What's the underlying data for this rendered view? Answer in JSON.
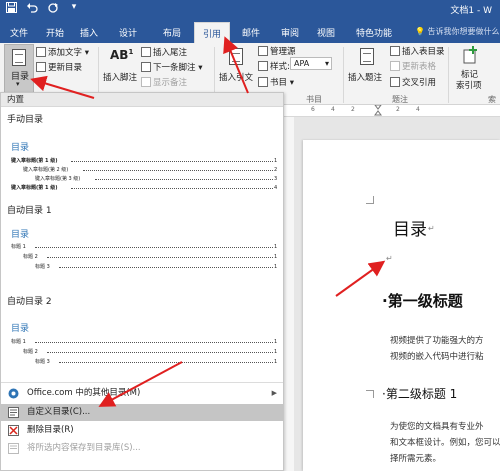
{
  "window": {
    "title": "文档1 - W",
    "qat": [
      "save-icon",
      "undo-icon",
      "redo-icon",
      "more-icon"
    ]
  },
  "tabs": [
    {
      "label": "文件"
    },
    {
      "label": "开始"
    },
    {
      "label": "插入"
    },
    {
      "label": "设计"
    },
    {
      "label": "布局"
    },
    {
      "label": "引用"
    },
    {
      "label": "邮件"
    },
    {
      "label": "审阅"
    },
    {
      "label": "视图"
    },
    {
      "label": "特色功能"
    }
  ],
  "tell_me": "告诉我你想要做什么",
  "ribbon": {
    "toc_label": "目录",
    "add_text": "添加文字",
    "update_toc": "更新目录",
    "insert_footnote": "插入脚注",
    "insert_endnote": "插入尾注",
    "next_footnote": "下一条脚注",
    "show_notes": "显示备注",
    "insert_citation": "插入引文",
    "manage_sources": "管理源",
    "style_label": "样式:",
    "style_value": "APA",
    "bibliography": "书目",
    "insert_caption": "插入题注",
    "insert_table_of_figures": "插入表目录",
    "update_table": "更新表格",
    "cross_reference": "交叉引用",
    "mark_entry": "标记",
    "mark_entry2": "索引项",
    "group_footnotes_tail": "书目",
    "group_captions": "题注",
    "group_index": "索引"
  },
  "dropdown": {
    "builtin": "内置",
    "manual_name": "手动目录",
    "manual_heading": "目录",
    "manual_lines": [
      {
        "text": "键入章标题(第 1 级)",
        "num": "1"
      },
      {
        "text": "键入章标题(第 2 级)",
        "num": "2"
      },
      {
        "text": "键入章标题(第 3 级)",
        "num": "3"
      },
      {
        "text": "键入章标题(第 1 级)",
        "num": "4"
      }
    ],
    "auto1_name": "自动目录 1",
    "auto1_heading": "目录",
    "auto1_lines": [
      {
        "text": "标题 1",
        "num": "1"
      },
      {
        "text": "标题 2",
        "num": "1"
      },
      {
        "text": "标题 3",
        "num": "1"
      }
    ],
    "auto2_name": "自动目录 2",
    "auto2_heading": "目录",
    "auto2_lines": [
      {
        "text": "标题 1",
        "num": "1"
      },
      {
        "text": "标题 2",
        "num": "1"
      },
      {
        "text": "标题 3",
        "num": "1"
      }
    ],
    "menu": {
      "office_more": "Office.com 中的其他目录(M)",
      "custom_toc": "自定义目录(C)...",
      "remove_toc": "删除目录(R)",
      "save_selection": "将所选内容保存到目录库(S)..."
    }
  },
  "ruler_numbers": [
    "6",
    "4",
    "2",
    "2",
    "4"
  ],
  "document": {
    "title": "目录",
    "heading1": "第一级标题",
    "para1_line1": "视频提供了功能强大的方",
    "para1_line2": "视频的嵌入代码中进行粘",
    "heading2": "第二级标题 1",
    "para2_line1": "为使您的文档具有专业外",
    "para2_line2": "和文本框设计。例如，您可以添",
    "para2_line3": "择所需元素。"
  },
  "colors": {
    "title_bar": "#2b579a",
    "toc_heading_blue": "#2e74b5",
    "annotation_red": "#e02020",
    "highlight": "#c5c5c5"
  }
}
